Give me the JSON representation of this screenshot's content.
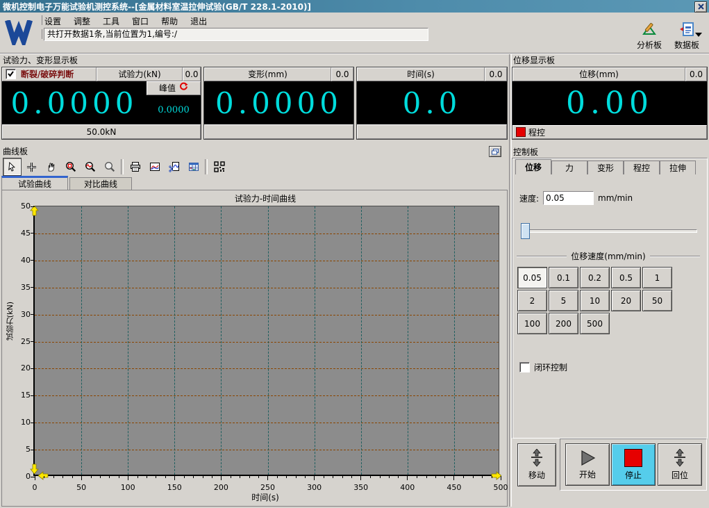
{
  "window": {
    "title": "微机控制电子万能试验机测控系统--[金属材料室温拉伸试验(GB/T 228.1-2010)]"
  },
  "menu": {
    "items": [
      "设置",
      "调整",
      "工具",
      "窗口",
      "帮助",
      "退出"
    ]
  },
  "statusbar": {
    "text": "共打开数据1条,当前位置为1,编号:/"
  },
  "toolbar": {
    "analysis_label": "分析板",
    "data_label": "数据板"
  },
  "display_section": {
    "title": "试验力、变形显示板"
  },
  "force_panel": {
    "break_check_label": "断裂/破碎判断",
    "header_label": "试验力(kN)",
    "header_value": "0.0",
    "value": "0.0000",
    "peak_label": "峰值",
    "peak_value": "0.0000",
    "range_label": "50.0kN"
  },
  "deform_panel": {
    "header_label": "变形(mm)",
    "header_value": "0.0",
    "value": "0.0000"
  },
  "time_panel": {
    "header_label": "时间(s)",
    "header_value": "0.0",
    "value": "0.0"
  },
  "displacement_panel": {
    "title": "位移显示板",
    "header_label": "位移(mm)",
    "header_value": "0.0",
    "value": "0.00",
    "mode_label": "程控"
  },
  "curve_panel": {
    "title": "曲线板",
    "tabs": [
      "试验曲线",
      "对比曲线"
    ],
    "active_tab": "试验曲线"
  },
  "chart_data": {
    "type": "line",
    "title": "试验力-时间曲线",
    "xlabel": "时间(s)",
    "ylabel": "试验力(kN)",
    "xlim": [
      0,
      500
    ],
    "ylim": [
      0,
      50
    ],
    "x_ticks": [
      0,
      50,
      100,
      150,
      200,
      250,
      300,
      350,
      400,
      450,
      500
    ],
    "y_ticks": [
      0,
      5,
      10,
      15,
      20,
      25,
      30,
      35,
      40,
      45,
      50
    ],
    "x_minor_step": 10,
    "grid": "dashed",
    "series": []
  },
  "control": {
    "title": "控制板",
    "tabs": [
      "位移",
      "力",
      "变形",
      "程控",
      "拉伸"
    ],
    "active_tab": "位移",
    "speed_label": "速度:",
    "speed_value": "0.05",
    "speed_unit": "mm/min",
    "speed_group_title": "位移速度(mm/min)",
    "speed_buttons": [
      "0.05",
      "0.1",
      "0.2",
      "0.5",
      "1",
      "2",
      "5",
      "10",
      "20",
      "50",
      "100",
      "200",
      "500"
    ],
    "active_speed": "0.05",
    "closed_loop_label": "闭环控制",
    "buttons": {
      "move": "移动",
      "start": "开始",
      "stop": "停止",
      "return": "回位"
    }
  },
  "icons": {
    "close": "x-glyph",
    "logo": "wance-w-mark",
    "analysis": "set-square-with-pencil",
    "data_board": "document-with-arrow",
    "dropdown": "caret-down",
    "peak_reset": "red-refresh-arrow",
    "program_mode": "red-square",
    "curve_tools": [
      "select-cursor",
      "move-crosshair",
      "pan-hand",
      "zoom-box",
      "zoom-curve",
      "zoom-out",
      "print",
      "curve-chart",
      "copy-curve",
      "data-table",
      "barcode"
    ],
    "float_panel": "cascade-windows",
    "move": "arrows-apart",
    "start": "play-triangle",
    "stop": "red-square",
    "return": "arrows-together"
  },
  "colors": {
    "titlebar": "#35708f",
    "digit_cyan": "#00dcdc",
    "display_black": "#000000",
    "break_label_red": "#7a1010",
    "plot_bg": "#8c8c8c",
    "hgrid": "#8a4500",
    "vgrid": "#1d5f5f",
    "axis_arrow_yellow": "#ffe800",
    "stop_button_bg": "#55cdeb",
    "stop_red": "#e60000",
    "window_bg": "#d6d3ce"
  }
}
